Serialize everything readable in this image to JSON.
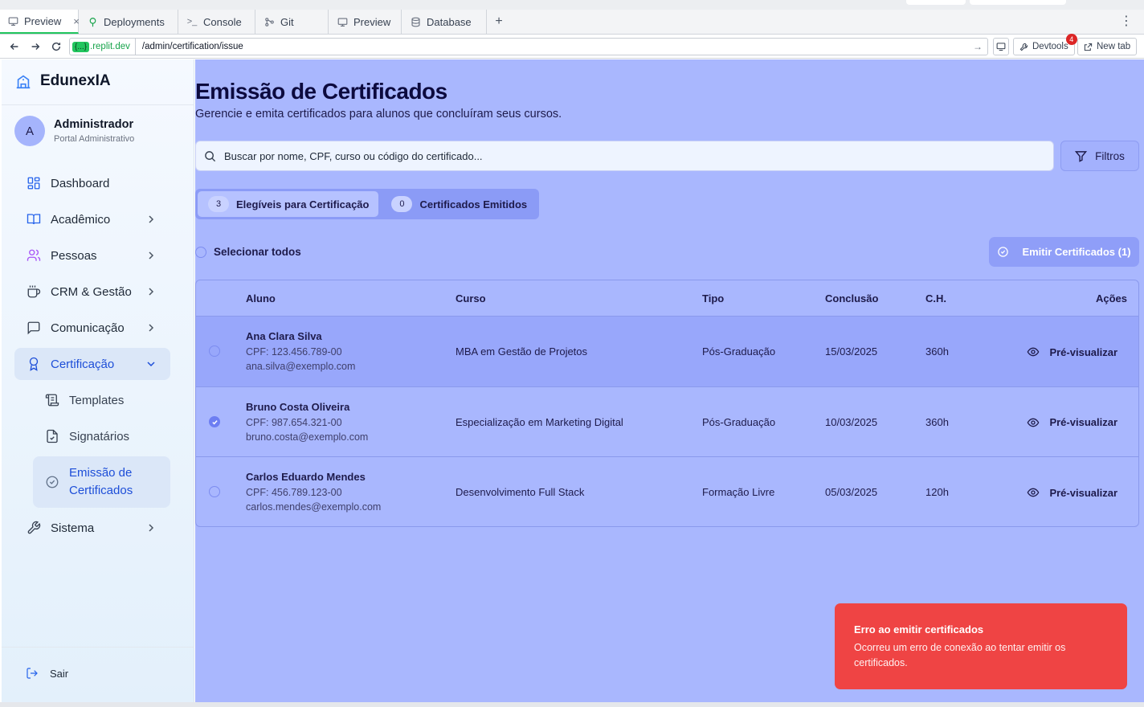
{
  "browser": {
    "tabs": [
      {
        "label": "Preview",
        "icon": "monitor-icon",
        "active": true
      },
      {
        "label": "Deployments",
        "icon": "tree-icon"
      },
      {
        "label": "Console",
        "icon": "terminal-icon"
      },
      {
        "label": "Git",
        "icon": "git-icon"
      },
      {
        "label": "Preview",
        "icon": "monitor-icon"
      },
      {
        "label": "Database",
        "icon": "database-icon"
      }
    ],
    "add_tab": "+",
    "url_host_badge": "{...}",
    "url_host": ".replit.dev",
    "url_path": "/admin/certification/issue",
    "devtools_label": "Devtools",
    "devtools_badge": "4",
    "newtab_label": "New tab"
  },
  "sidebar": {
    "brand": "EdunexIA",
    "user": {
      "initial": "A",
      "name": "Administrador",
      "role": "Portal Administrativo"
    },
    "items": [
      {
        "label": "Dashboard",
        "icon": "dashboard-icon"
      },
      {
        "label": "Acadêmico",
        "icon": "book-icon"
      },
      {
        "label": "Pessoas",
        "icon": "users-icon"
      },
      {
        "label": "CRM & Gestão",
        "icon": "coffee-icon"
      },
      {
        "label": "Comunicação",
        "icon": "chat-icon"
      },
      {
        "label": "Certificação",
        "icon": "award-icon",
        "active": true
      },
      {
        "label": "Sistema",
        "icon": "wrench-icon"
      }
    ],
    "subitems": [
      {
        "label": "Templates",
        "icon": "scroll-icon"
      },
      {
        "label": "Signatários",
        "icon": "file-signature-icon"
      },
      {
        "label": "Emissão de Certificados",
        "icon": "check-circle-icon",
        "active": true
      }
    ],
    "logout": "Sair"
  },
  "main": {
    "title": "Emissão de Certificados",
    "subtitle": "Gerencie e emita certificados para alunos que concluíram seus cursos.",
    "search_placeholder": "Buscar por nome, CPF, curso ou código do certificado...",
    "filters_label": "Filtros",
    "tabs": [
      {
        "count": "3",
        "label": "Elegíveis para Certificação",
        "active": true
      },
      {
        "count": "0",
        "label": "Certificados Emitidos"
      }
    ],
    "select_all": "Selecionar todos",
    "emit_button": "Emitir Certificados (1)",
    "table": {
      "headers": {
        "aluno": "Aluno",
        "curso": "Curso",
        "tipo": "Tipo",
        "conclusao": "Conclusão",
        "ch": "C.H.",
        "acoes": "Ações"
      },
      "rows": [
        {
          "name": "Ana Clara Silva",
          "cpf": "CPF: 123.456.789-00",
          "email": "ana.silva@exemplo.com",
          "curso": "MBA em Gestão de Projetos",
          "tipo": "Pós-Graduação",
          "conclusao": "15/03/2025",
          "ch": "360h",
          "action": "Pré-visualizar",
          "selected": false
        },
        {
          "name": "Bruno Costa Oliveira",
          "cpf": "CPF: 987.654.321-00",
          "email": "bruno.costa@exemplo.com",
          "curso": "Especialização em Marketing Digital",
          "tipo": "Pós-Graduação",
          "conclusao": "10/03/2025",
          "ch": "360h",
          "action": "Pré-visualizar",
          "selected": true
        },
        {
          "name": "Carlos Eduardo Mendes",
          "cpf": "CPF: 456.789.123-00",
          "email": "carlos.mendes@exemplo.com",
          "curso": "Desenvolvimento Full Stack",
          "tipo": "Formação Livre",
          "conclusao": "05/03/2025",
          "ch": "120h",
          "action": "Pré-visualizar",
          "selected": false
        }
      ]
    }
  },
  "toast": {
    "title": "Erro ao emitir certificados",
    "message": "Ocorreu um erro de conexão ao tentar emitir os certificados."
  },
  "colors": {
    "accent": "#2563eb",
    "main_bg": "#a9b7fe",
    "toast_bg": "#ef4444"
  }
}
